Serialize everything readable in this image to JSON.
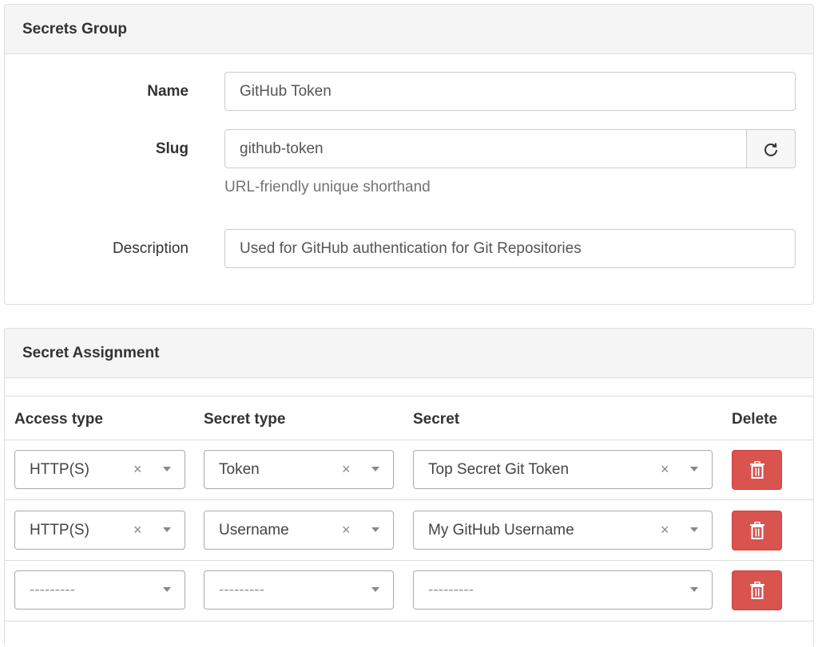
{
  "secrets_group": {
    "title": "Secrets Group",
    "name_label": "Name",
    "name_value": "GitHub Token",
    "slug_label": "Slug",
    "slug_value": "github-token",
    "slug_help": "URL-friendly unique shorthand",
    "description_label": "Description",
    "description_value": "Used for GitHub authentication for Git Repositories",
    "regenerate_icon": "refresh-icon"
  },
  "secret_assignment": {
    "title": "Secret Assignment",
    "columns": {
      "access_type": "Access type",
      "secret_type": "Secret type",
      "secret": "Secret",
      "delete": "Delete"
    },
    "rows": [
      {
        "access_type": "HTTP(S)",
        "secret_type": "Token",
        "secret": "Top Secret Git Token"
      },
      {
        "access_type": "HTTP(S)",
        "secret_type": "Username",
        "secret": "My GitHub Username"
      },
      {
        "access_type": "---------",
        "secret_type": "---------",
        "secret": "---------"
      }
    ],
    "clear_symbol": "×",
    "delete_icon": "trash-icon",
    "delete_color": "#d9534f"
  }
}
